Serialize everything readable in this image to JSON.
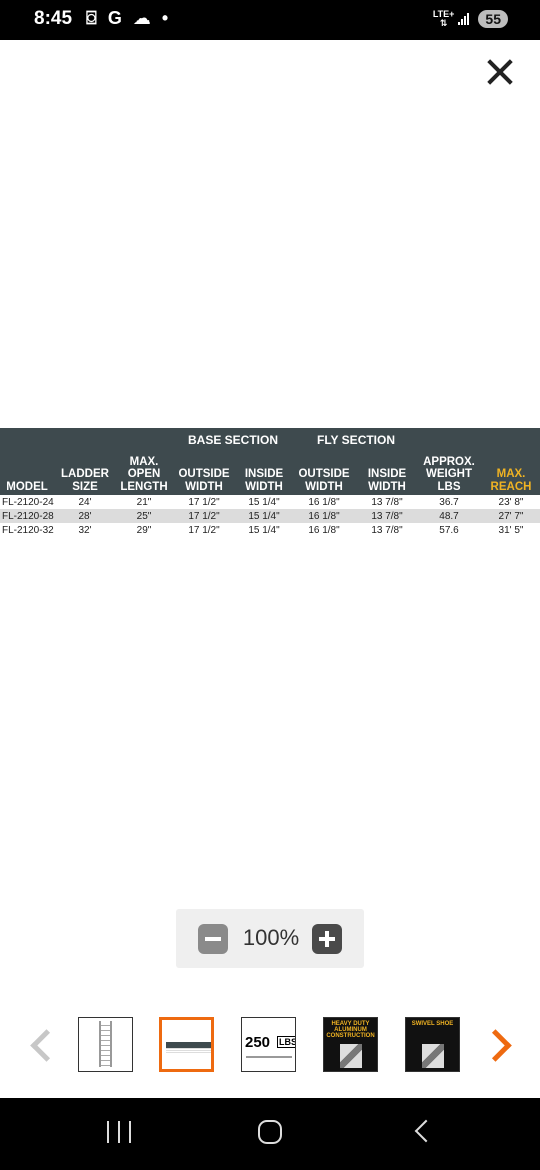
{
  "status_bar": {
    "time": "8:45",
    "notification_icons": [
      "screenshot-icon",
      "G",
      "cloud-icon",
      "•"
    ],
    "network": "LTE+",
    "battery": "55"
  },
  "spec_table": {
    "section_labels": {
      "base": "BASE SECTION",
      "fly": "FLY SECTION"
    },
    "headers": [
      "MODEL",
      "LADDER\nSIZE",
      "MAX.\nOPEN\nLENGTH",
      "OUTSIDE\nWIDTH",
      "INSIDE\nWIDTH",
      "OUTSIDE\nWIDTH",
      "INSIDE\nWIDTH",
      "APPROX.\nWEIGHT\nLBS",
      "MAX.\nREACH"
    ],
    "rows": [
      [
        "FL-2120-24",
        "24'",
        "21\"",
        "17 1/2\"",
        "15 1/4\"",
        "16 1/8\"",
        "13 7/8\"",
        "36.7",
        "23' 8\""
      ],
      [
        "FL-2120-28",
        "28'",
        "25\"",
        "17 1/2\"",
        "15 1/4\"",
        "16 1/8\"",
        "13 7/8\"",
        "48.7",
        "27' 7\""
      ],
      [
        "FL-2120-32",
        "32'",
        "29\"",
        "17 1/2\"",
        "15 1/4\"",
        "16 1/8\"",
        "13 7/8\"",
        "57.6",
        "31' 5\""
      ]
    ],
    "header_bg": "#3e4a4e",
    "reach_color": "#f0b323"
  },
  "zoom": {
    "level": "100%"
  },
  "thumbnails": [
    {
      "name": "ladder"
    },
    {
      "name": "spec-table",
      "selected": true
    },
    {
      "name": "weight-capacity",
      "text": "250",
      "unit": "LBS"
    },
    {
      "name": "heavy-duty",
      "caption": "HEAVY DUTY\nALUMINUM\nCONSTRUCTION"
    },
    {
      "name": "swivel-shoe",
      "caption": "SWIVEL SHOE"
    }
  ],
  "colors": {
    "accent": "#ee6a10",
    "nav_bar": "#000000"
  }
}
